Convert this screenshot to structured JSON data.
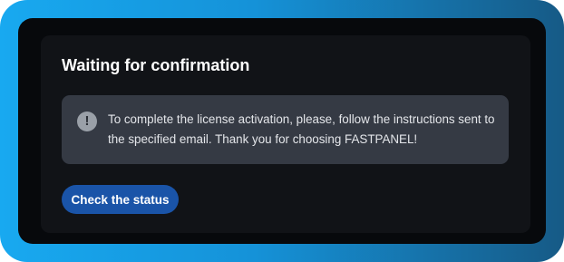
{
  "dialog": {
    "title": "Waiting for confirmation",
    "notice": {
      "icon": "exclamation-circle-icon",
      "glyph": "!",
      "text": "To complete the license activation, please, follow the instructions sent to the specified email. Thank you for choosing FASTPANEL!"
    },
    "check_status_label": "Check the status"
  },
  "colors": {
    "frame_gradient_start": "#18a9f0",
    "frame_gradient_end": "#165a86",
    "screen_background": "#07090c",
    "card_background": "#111317",
    "notice_background": "#353a44",
    "button_background": "#1a54a8",
    "text_primary": "#ffffff"
  }
}
